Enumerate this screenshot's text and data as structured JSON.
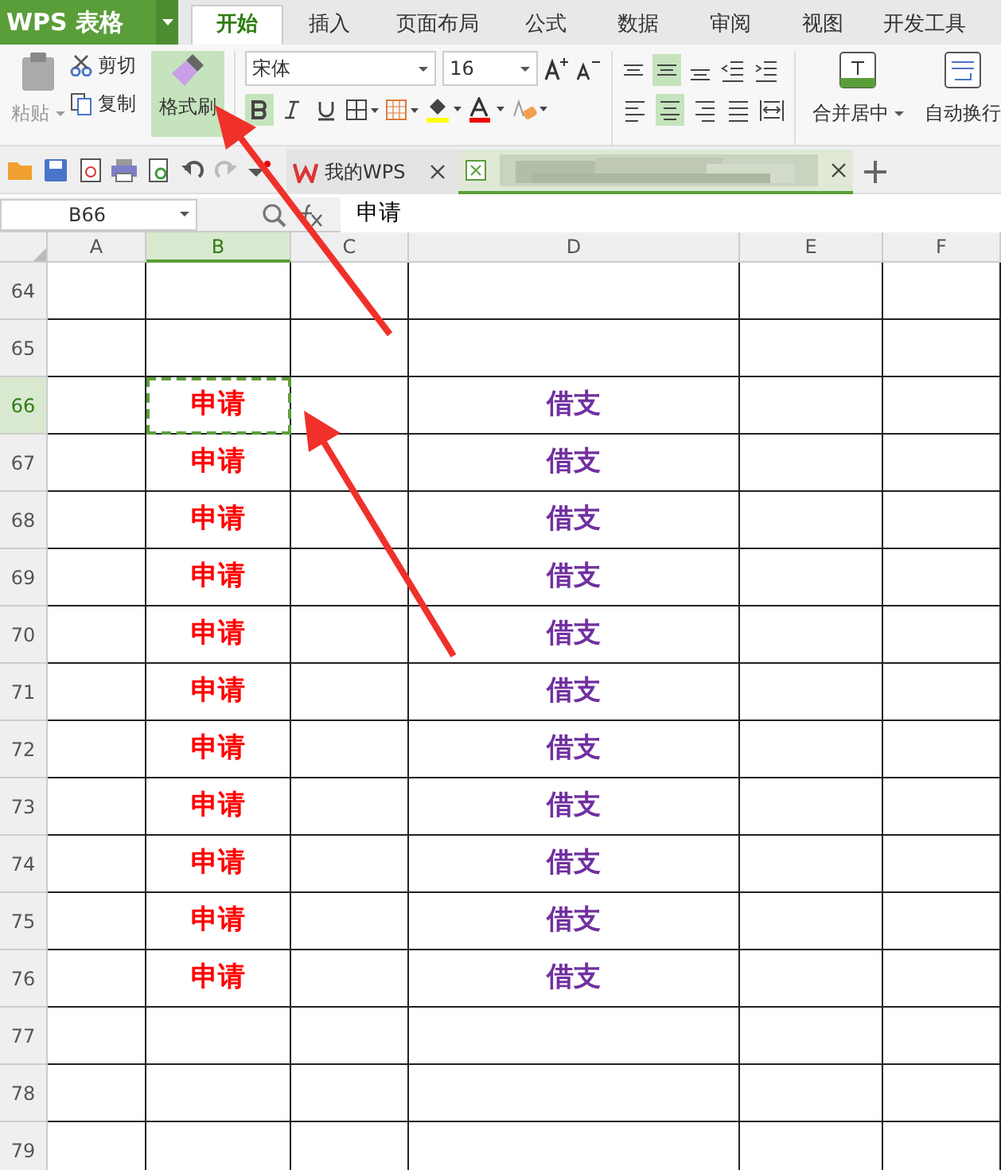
{
  "app_button": {
    "label": "WPS 表格"
  },
  "ribbon_tabs": [
    {
      "label": "开始",
      "selected": true
    },
    {
      "label": "插入",
      "selected": false
    },
    {
      "label": "页面布局",
      "selected": false
    },
    {
      "label": "公式",
      "selected": false
    },
    {
      "label": "数据",
      "selected": false
    },
    {
      "label": "审阅",
      "selected": false
    },
    {
      "label": "视图",
      "selected": false
    },
    {
      "label": "开发工具",
      "selected": false
    }
  ],
  "clipboard": {
    "paste": {
      "label": "粘贴",
      "disabled": true
    },
    "cut": {
      "label": "剪切"
    },
    "copy": {
      "label": "复制"
    },
    "format_painter": {
      "label": "格式刷",
      "active": true
    }
  },
  "font": {
    "name": "宋体",
    "size": "16",
    "bold": true,
    "italic": false,
    "underline": false
  },
  "alignment": {
    "top_center": true,
    "center": true
  },
  "merge": {
    "label": "合并居中"
  },
  "wrap": {
    "label": "自动换行"
  },
  "doc_tabs": [
    {
      "label": "我的WPS",
      "selected": false
    },
    {
      "kind": "picture",
      "selected": true
    }
  ],
  "name_box": "B66",
  "formula": "申请",
  "columns": [
    {
      "label": "A",
      "selected": false
    },
    {
      "label": "B",
      "selected": true
    },
    {
      "label": "C",
      "selected": false
    },
    {
      "label": "D",
      "selected": false
    },
    {
      "label": "E",
      "selected": false
    },
    {
      "label": "F",
      "selected": false
    }
  ],
  "rows": [
    {
      "number": "64",
      "selected": false
    },
    {
      "number": "65",
      "selected": false
    },
    {
      "number": "66",
      "selected": true,
      "b": {
        "text": "申请",
        "color": "#ff0000"
      },
      "d": {
        "text": "借支",
        "color": "#7030a0"
      }
    },
    {
      "number": "67",
      "selected": false,
      "b": {
        "text": "申请",
        "color": "#ff0000"
      },
      "d": {
        "text": "借支",
        "color": "#7030a0"
      }
    },
    {
      "number": "68",
      "selected": false,
      "b": {
        "text": "申请",
        "color": "#ff0000"
      },
      "d": {
        "text": "借支",
        "color": "#7030a0"
      }
    },
    {
      "number": "69",
      "selected": false,
      "b": {
        "text": "申请",
        "color": "#ff0000"
      },
      "d": {
        "text": "借支",
        "color": "#7030a0"
      }
    },
    {
      "number": "70",
      "selected": false,
      "b": {
        "text": "申请",
        "color": "#ff0000"
      },
      "d": {
        "text": "借支",
        "color": "#7030a0"
      }
    },
    {
      "number": "71",
      "selected": false,
      "b": {
        "text": "申请",
        "color": "#ff0000"
      },
      "d": {
        "text": "借支",
        "color": "#7030a0"
      }
    },
    {
      "number": "72",
      "selected": false,
      "b": {
        "text": "申请",
        "color": "#ff0000"
      },
      "d": {
        "text": "借支",
        "color": "#7030a0"
      }
    },
    {
      "number": "73",
      "selected": false,
      "b": {
        "text": "申请",
        "color": "#ff0000"
      },
      "d": {
        "text": "借支",
        "color": "#7030a0"
      }
    },
    {
      "number": "74",
      "selected": false,
      "b": {
        "text": "申请",
        "color": "#ff0000"
      },
      "d": {
        "text": "借支",
        "color": "#7030a0"
      }
    },
    {
      "number": "75",
      "selected": false,
      "b": {
        "text": "申请",
        "color": "#ff0000"
      },
      "d": {
        "text": "借支",
        "color": "#7030a0"
      }
    },
    {
      "number": "76",
      "selected": false,
      "b": {
        "text": "申请",
        "color": "#ff0000"
      },
      "d": {
        "text": "借支",
        "color": "#7030a0"
      }
    },
    {
      "number": "77",
      "selected": false
    },
    {
      "number": "78",
      "selected": false
    },
    {
      "number": "79",
      "selected": false
    }
  ]
}
